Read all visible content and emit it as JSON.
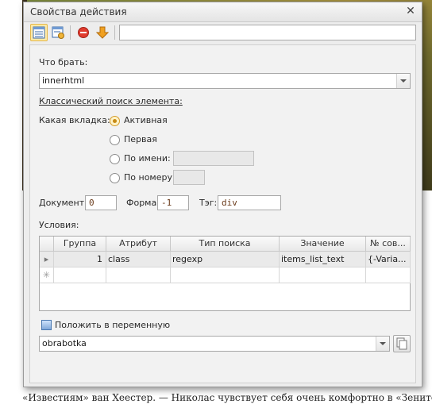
{
  "dialog": {
    "title": "Свойства действия"
  },
  "toolbar": {
    "buttons": [
      "grid-view-icon",
      "settings-icon",
      "stop-icon",
      "down-arrow-icon"
    ],
    "search_value": ""
  },
  "form": {
    "what_label": "Что брать:",
    "what_value": "innerhtml",
    "classic_search_label": "Классический поиск элемента:",
    "tab_label": "Какая вкладка:",
    "tab_options": [
      "Активная",
      "Первая",
      "По имени:",
      "По номеру:"
    ],
    "tab_selected": "Активная",
    "document_label": "Документ:",
    "document_value": "0",
    "form_label": "Форма:",
    "form_value": "-1",
    "tag_label": "Тэг:",
    "tag_value": "div",
    "conditions_label": "Условия:",
    "put_var_label": "Положить в переменную",
    "var_value": "obrabotka"
  },
  "grid": {
    "columns": [
      "Группа",
      "Атрибут",
      "Тип поиска",
      "Значение",
      "№ сов..."
    ],
    "rows": [
      {
        "group": "1",
        "attribute": "class",
        "search_type": "regexp",
        "value": "items_list_text",
        "match": "{-Varia..."
      }
    ]
  },
  "background": {
    "line1": "«Известиям» ван Хеестер. — Николас чувствует себя очень комфортно в «Зените» и"
  },
  "colors": {
    "active_button": "#fde9a7",
    "stop": "#e03b2e",
    "arrow": "#f0a020"
  }
}
